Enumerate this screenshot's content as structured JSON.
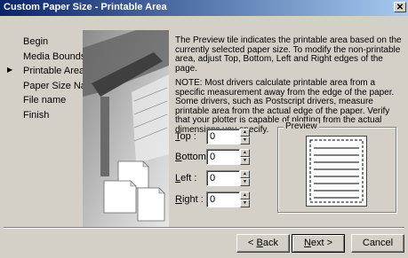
{
  "window": {
    "title": "Custom Paper Size - Printable Area"
  },
  "steps": [
    {
      "label": "Begin",
      "current": false
    },
    {
      "label": "Media Bounds",
      "current": false
    },
    {
      "label": "Printable Area",
      "current": true
    },
    {
      "label": "Paper Size Name",
      "current": false
    },
    {
      "label": "File name",
      "current": false
    },
    {
      "label": "Finish",
      "current": false
    }
  ],
  "description": {
    "p1": "The Preview tile indicates the printable area based on the currently selected paper size. To modify the non-printable area, adjust Top, Bottom, Left and Right edges of the page.",
    "p2": "NOTE: Most drivers calculate printable area from a specific measurement away from the edge of the paper. Some drivers, such as Postscript drivers, measure printable area from the actual edge of the paper. Verify that your plotter is capable of plotting from the actual dimensions you specify."
  },
  "fields": {
    "top": {
      "access": "T",
      "rest": "op :",
      "value": "0"
    },
    "bottom": {
      "access": "B",
      "rest": "ottom :",
      "value": "0"
    },
    "left": {
      "access": "L",
      "rest": "eft :",
      "value": "0"
    },
    "right": {
      "access": "R",
      "rest": "ight :",
      "value": "0"
    }
  },
  "preview": {
    "label": "Preview"
  },
  "buttons": {
    "back": {
      "arrow": "< ",
      "access": "B",
      "rest": "ack"
    },
    "next": {
      "access": "N",
      "rest": "ext >"
    },
    "cancel": {
      "label": "Cancel"
    }
  }
}
